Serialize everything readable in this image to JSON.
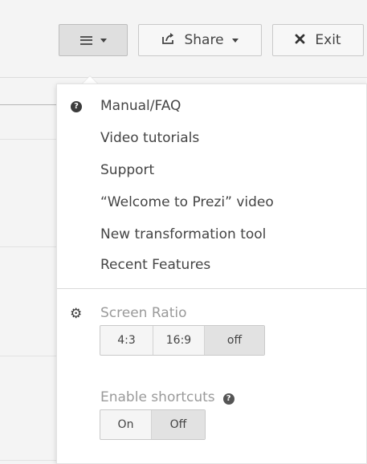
{
  "toolbar": {
    "menu_icon": "hamburger-icon",
    "share_label": "Share",
    "share_icon": "share-icon",
    "exit_label": "Exit",
    "exit_icon": "close-icon"
  },
  "menu": {
    "help_icon": "question-circle-icon",
    "items": [
      {
        "label": "Manual/FAQ"
      },
      {
        "label": "Video tutorials"
      },
      {
        "label": "Support"
      },
      {
        "label": "“Welcome to Prezi” video"
      },
      {
        "label": "New transformation tool"
      },
      {
        "label": "Recent Features"
      }
    ]
  },
  "screen_ratio": {
    "icon": "gear-icon",
    "label": "Screen Ratio",
    "options": [
      "4:3",
      "16:9",
      "off"
    ],
    "selected": "off"
  },
  "shortcuts": {
    "label": "Enable shortcuts",
    "help_icon": "question-circle-icon",
    "options": [
      "On",
      "Off"
    ],
    "selected": "Off"
  }
}
